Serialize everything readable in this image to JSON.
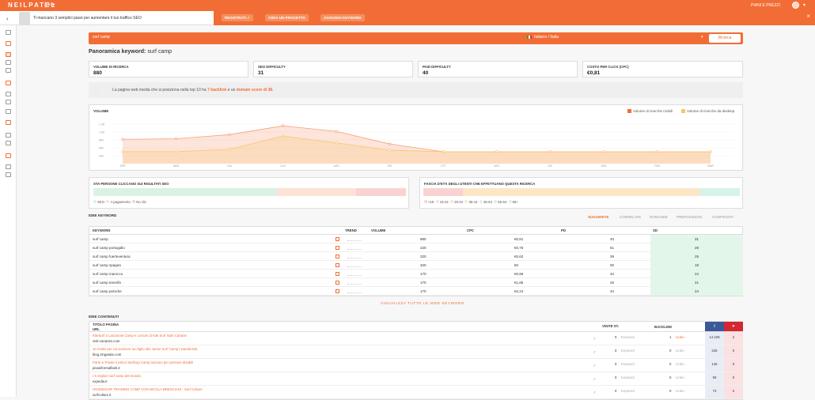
{
  "topbar": {
    "brand": "NEILPATEL",
    "brand_menu": "| ≡ ▾",
    "plans": "PIANI E PREZZI",
    "avatar_caret": "▾"
  },
  "promo": {
    "back": "‹",
    "text": "Ti mancano 3 semplici passi per aumentare il tuo traffico SEO",
    "btn1": "REGISTRATI ✓",
    "btn2": "CREA UN PROGETTO",
    "btn3": "AGGIUNGI KEYWORD",
    "close": "×"
  },
  "search": {
    "query": "surf camp",
    "language": "Italiano / Italia",
    "caret": "▾",
    "button": "Ricerca"
  },
  "overview": {
    "title": "Panoramica keyword:",
    "keyword": "surf camp"
  },
  "metrics": [
    {
      "label": "VOLUME DI RICERCA",
      "value": "880"
    },
    {
      "label": "SEO DIFFICULTY",
      "value": "31"
    },
    {
      "label": "PAID DIFFICULTY",
      "value": "40"
    },
    {
      "label": "COSTO PER CLICK (CPC)",
      "value": "€0,81"
    }
  ],
  "info": {
    "pre": "La pagina web media che si posiziona nella top 10 ha",
    "backlinks": "7 backlink",
    "mid": "e un",
    "domain": "domain score di 38."
  },
  "volume": {
    "title": "VOLUME",
    "legend_mobile": "Volume di ricerche mobili",
    "legend_desktop": "Volume di ricerche da desktop"
  },
  "chart_data": {
    "type": "area",
    "categories": [
      "APR",
      "MAG",
      "GIU",
      "LUG",
      "AGO",
      "SET",
      "OTT",
      "NOV",
      "DIC",
      "GEN",
      "FEB",
      "MAR"
    ],
    "yticks": [
      "1.3K",
      "1.0K",
      "800",
      "600",
      "300"
    ],
    "series": [
      {
        "name": "Volume di ricerche mobili",
        "values": [
          720,
          740,
          880,
          1180,
          990,
          560,
          300,
          300,
          300,
          300,
          300,
          300
        ]
      },
      {
        "name": "Volume di ricerche da desktop",
        "values": [
          300,
          300,
          380,
          830,
          600,
          350,
          300,
          300,
          300,
          300,
          300,
          300
        ]
      }
    ],
    "ylim": [
      0,
      1400
    ]
  },
  "seo_clicks": {
    "title": "STA PERSONE CLICCANO SUI RISULTATI SEO",
    "legend": [
      "SEO",
      "A pagamento",
      "No clic"
    ],
    "colors": [
      "#d9f2e3",
      "#fde2d5",
      "#f9d3d3"
    ]
  },
  "ages": {
    "title": "FASCIA D'ETÀ DEGLI UTENTI CHE EFFETTUANO QUESTA RICERCA",
    "legend": [
      "<18",
      "18-24",
      "25-34",
      "35-44",
      "45-54",
      "55-64",
      "65+"
    ],
    "colors": [
      "#f9d3d3",
      "#fde2d5",
      "#fbe7c5",
      "#f3efc8",
      "#e8f1d1",
      "#dcf0e2",
      "#d8f2ec"
    ]
  },
  "keyword_ideas": {
    "title": "IDEE KEYWORD",
    "tabs": [
      "SUGGERITE",
      "CORRELATE",
      "DOMANDE",
      "PREPOSIZIONI",
      "CONFRONTI"
    ],
    "headers": {
      "keyword": "KEYWORD",
      "trend": "TREND",
      "volume": "VOLUME",
      "cpc": "CPC",
      "pd": "PD",
      "sd": "SD"
    },
    "rows": [
      {
        "keyword": "surf camp",
        "volume": "880",
        "cpc": "€0,81",
        "pd": "40",
        "sd": "31"
      },
      {
        "keyword": "surf camp portogallo",
        "volume": "320",
        "cpc": "€0,76",
        "pd": "51",
        "sd": "29"
      },
      {
        "keyword": "surf camp fuerteventura",
        "volume": "320",
        "cpc": "€0,62",
        "pd": "39",
        "sd": "25"
      },
      {
        "keyword": "surf camp spagna",
        "volume": "320",
        "cpc": "€0",
        "pd": "00",
        "sd": "18"
      },
      {
        "keyword": "surf camp marocco",
        "volume": "170",
        "cpc": "€0,96",
        "pd": "34",
        "sd": "24"
      },
      {
        "keyword": "surf camp tenerife",
        "volume": "170",
        "cpc": "€1,85",
        "pd": "26",
        "sd": "21"
      },
      {
        "keyword": "surf camp peniche",
        "volume": "170",
        "cpc": "€2,24",
        "pd": "34",
        "sd": "24"
      }
    ],
    "view_all": "VISUALIZZA TUTTE LE IDEE KEYWORD"
  },
  "content_ideas": {
    "title": "IDEE CONTENUTI",
    "headers": {
      "title": "TITOLO PAGINA",
      "url": "URL",
      "visits": "VISITE ST.",
      "backlinks": "BACKLINK",
      "fb": "f",
      "pin": "P"
    },
    "rows": [
      {
        "title": "KiteSurf a Lanzarote Camp e Lezioni di Kite Surf Isole Canarie",
        "url": "visit-canaries.com",
        "visits": "0",
        "visits_label": "Keyword",
        "backlinks": "1",
        "backlinks_link": "Links ›",
        "fb": "14.228",
        "pin": "2"
      },
      {
        "title": "10 motivi per cui iscrivere tuo figlio allo Junior Surf Camp | wanderlust",
        "url": "blog.zingarate.com",
        "visits": "0",
        "visits_label": "Keyword",
        "backlinks": "0",
        "backlinks_link": "Links ›",
        "fb": "225",
        "pin": "0"
      },
      {
        "title": "Parte a Trieste il primo SurfSup Camp toscano per persone disabili",
        "url": "pisainformaflash.it",
        "visits": "0",
        "visits_label": "Keyword",
        "backlinks": "0",
        "backlinks_link": "Links ›",
        "fb": "145",
        "pin": "0"
      },
      {
        "title": "I 5 migliori surf camp del mondo",
        "url": "expedia.it",
        "visits": "0",
        "visits_label": "Keyword",
        "backlinks": "0",
        "backlinks_link": "Links ›",
        "fb": "93",
        "pin": "0"
      },
      {
        "title": "HOSSEGOR TRAINING CAMP CON NICOLA BRESCIANI - Surf Culture",
        "url": "surfculture.it",
        "visits": "0",
        "visits_label": "Keyword",
        "backlinks": "0",
        "backlinks_link": "Links ›",
        "fb": "73",
        "pin": "0"
      }
    ]
  }
}
